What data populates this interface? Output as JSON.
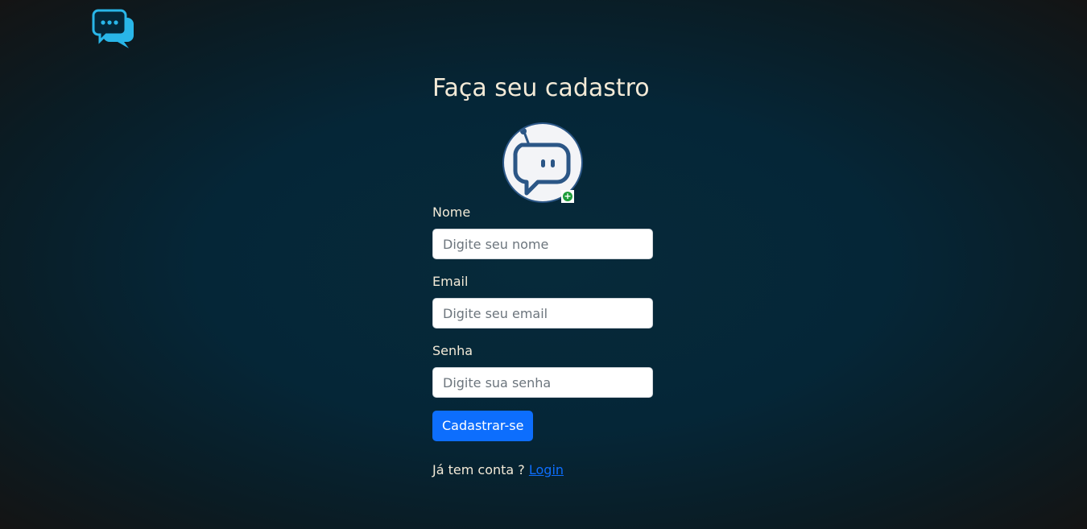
{
  "page": {
    "title": "Faça seu cadastro"
  },
  "brand": {
    "logo_icon": "chat-bubbles-icon",
    "accent": "#29b6e8"
  },
  "avatar": {
    "icon": "robot-chat-icon",
    "badge_icon": "plus-icon",
    "badge_symbol": "+"
  },
  "form": {
    "name": {
      "label": "Nome",
      "placeholder": "Digite seu nome",
      "value": ""
    },
    "email": {
      "label": "Email",
      "placeholder": "Digite seu email",
      "value": ""
    },
    "password": {
      "label": "Senha",
      "placeholder": "Digite sua senha",
      "value": ""
    },
    "submit_label": "Cadastrar-se"
  },
  "footer": {
    "prompt": "Já tem conta ?",
    "login_link": "Login"
  },
  "colors": {
    "background": "#052637",
    "text": "#f3ead7",
    "primary": "#0d6efd",
    "badge_green": "#1f9d3a",
    "avatar_outline": "#2b5686"
  }
}
